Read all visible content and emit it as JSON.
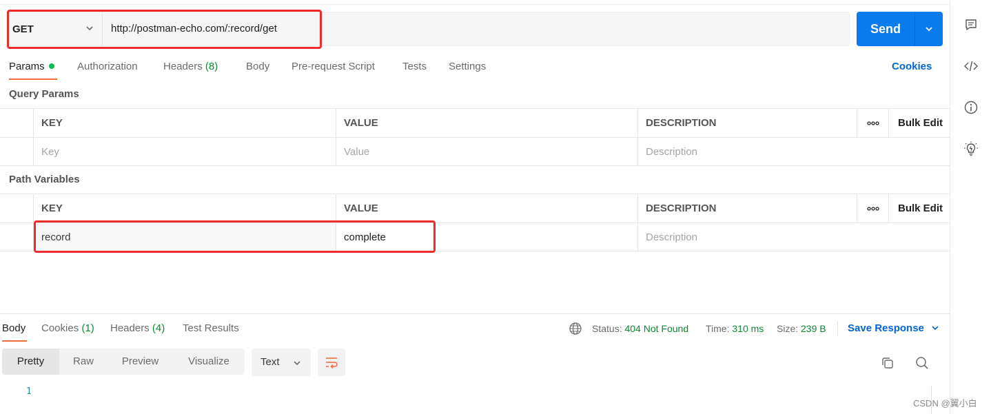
{
  "request": {
    "method": "GET",
    "url": "http://postman-echo.com/:record/get",
    "send_label": "Send"
  },
  "tabs": [
    {
      "label": "Params",
      "count": ""
    },
    {
      "label": "Authorization",
      "count": ""
    },
    {
      "label": "Headers",
      "count": "(8)"
    },
    {
      "label": "Body",
      "count": ""
    },
    {
      "label": "Pre-request Script",
      "count": ""
    },
    {
      "label": "Tests",
      "count": ""
    },
    {
      "label": "Settings",
      "count": ""
    }
  ],
  "cookies_label": "Cookies",
  "query_params": {
    "title": "Query Params",
    "headers": {
      "key": "KEY",
      "value": "VALUE",
      "description": "DESCRIPTION",
      "bulk_edit": "Bulk Edit"
    },
    "placeholders": {
      "key": "Key",
      "value": "Value",
      "description": "Description"
    }
  },
  "path_variables": {
    "title": "Path Variables",
    "headers": {
      "key": "KEY",
      "value": "VALUE",
      "description": "DESCRIPTION",
      "bulk_edit": "Bulk Edit"
    },
    "rows": [
      {
        "key": "record",
        "value": "complete",
        "description_placeholder": "Description"
      }
    ]
  },
  "response": {
    "tabs": [
      {
        "label": "Body",
        "count": ""
      },
      {
        "label": "Cookies",
        "count": "(1)"
      },
      {
        "label": "Headers",
        "count": "(4)"
      },
      {
        "label": "Test Results",
        "count": ""
      }
    ],
    "status_label": "Status:",
    "status_value": "404 Not Found",
    "time_label": "Time:",
    "time_value": "310 ms",
    "size_label": "Size:",
    "size_value": "239 B",
    "save_label": "Save Response",
    "view_modes": [
      "Pretty",
      "Raw",
      "Preview",
      "Visualize"
    ],
    "format": "Text",
    "line_number": "1"
  },
  "icons": {
    "comments": "comment-icon",
    "code": "code-icon",
    "info": "info-icon",
    "bulb": "lightbulb-icon",
    "globe": "globe-icon",
    "wrap": "wrap-lines-icon",
    "copy": "copy-icon",
    "search": "search-icon"
  },
  "colors": {
    "send": "#097bed",
    "active_tab": "#f26b3a",
    "link": "#0265d2",
    "success": "#0b8a2e",
    "highlight": "#ee2b2b"
  },
  "watermark": "CSDN @翼小白"
}
